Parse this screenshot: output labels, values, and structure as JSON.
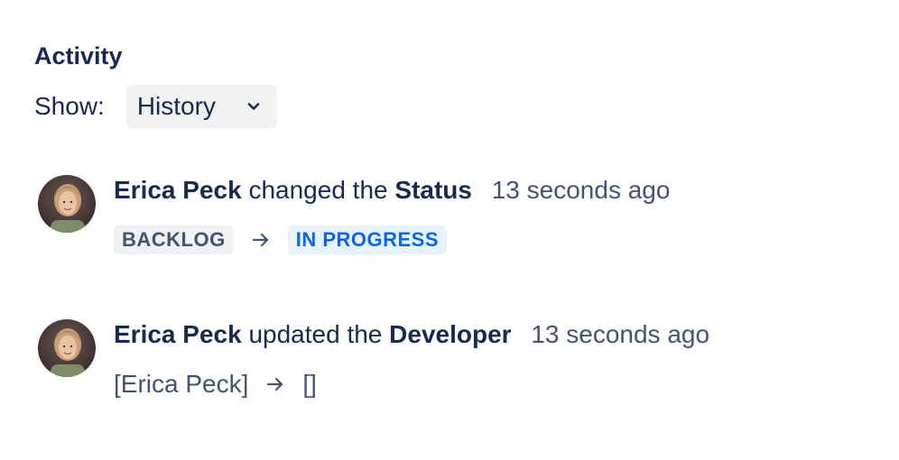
{
  "activity": {
    "title": "Activity",
    "show_label": "Show:",
    "filter_value": "History"
  },
  "entries": [
    {
      "actor": "Erica Peck",
      "verb": "changed the",
      "field": "Status",
      "time": "13 seconds ago",
      "from": "BACKLOG",
      "to": "IN PROGRESS"
    },
    {
      "actor": "Erica Peck",
      "verb": "updated the",
      "field": "Developer",
      "time": "13 seconds ago",
      "from": "[Erica Peck]",
      "to": "[]"
    }
  ],
  "colors": {
    "text": "#172b4d",
    "subtle": "#44546f",
    "lozenge_grey_bg": "#f1f2f4",
    "lozenge_blue_bg": "#e9f2ff",
    "lozenge_blue_text": "#0c66e4"
  },
  "icons": {
    "dropdown": "chevron-down-icon",
    "transition": "arrow-right-icon",
    "avatar": "user-avatar"
  }
}
